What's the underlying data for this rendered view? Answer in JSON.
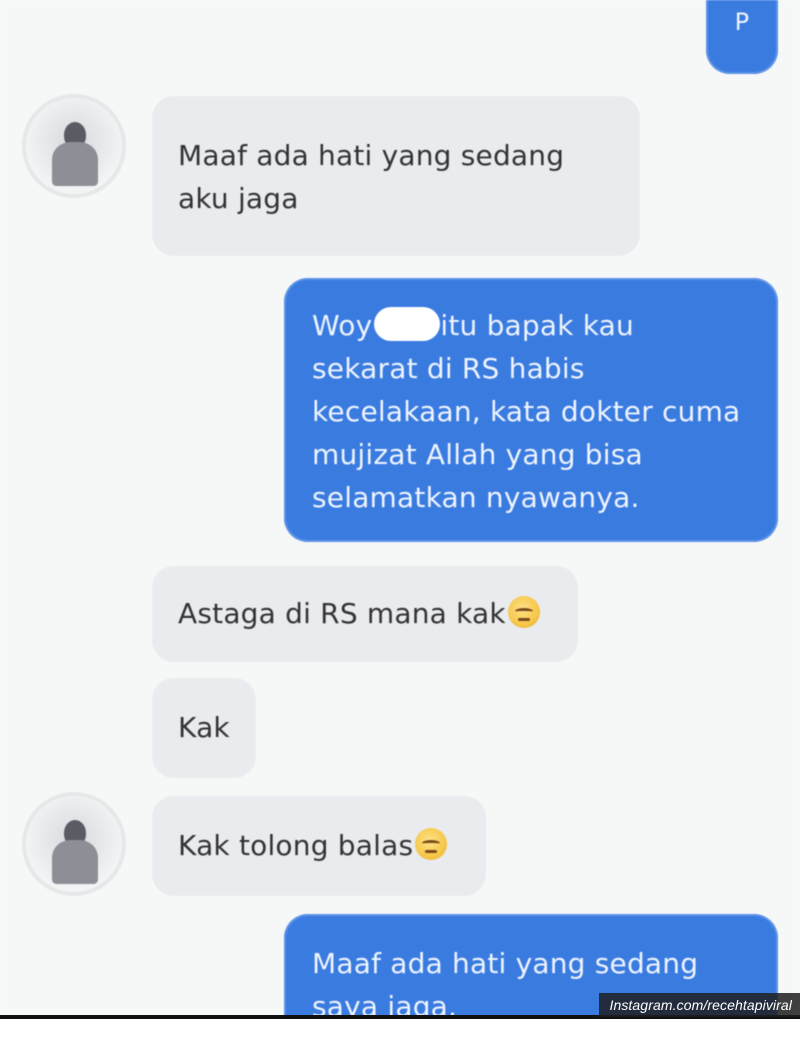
{
  "messages": [
    {
      "side": "outgoing",
      "text": "P"
    },
    {
      "side": "incoming",
      "lines": [
        "Maaf ada hati yang sedang",
        "aku jaga"
      ]
    },
    {
      "side": "outgoing",
      "line1_before": "Woy",
      "line1_after": "itu bapak kau",
      "lines": [
        "sekarat di RS habis",
        "kecelakaan, kata dokter cuma",
        "mujizat Allah yang bisa",
        "selamatkan nyawanya."
      ]
    },
    {
      "side": "incoming",
      "text": "Astaga di RS mana kak",
      "emoji": "downcast-sweat-emoji"
    },
    {
      "side": "incoming",
      "text": "Kak"
    },
    {
      "side": "incoming",
      "text": "Kak tolong balas",
      "emoji": "downcast-sweat-emoji"
    },
    {
      "side": "outgoing",
      "lines": [
        "Maaf ada hati yang sedang",
        "saya jaga."
      ]
    }
  ],
  "watermark": "Instagram.com/recehtapiviral",
  "colors": {
    "outgoing_bubble": "#3a7be0",
    "incoming_bubble": "#e9ebee",
    "background": "#f5f8f6"
  }
}
